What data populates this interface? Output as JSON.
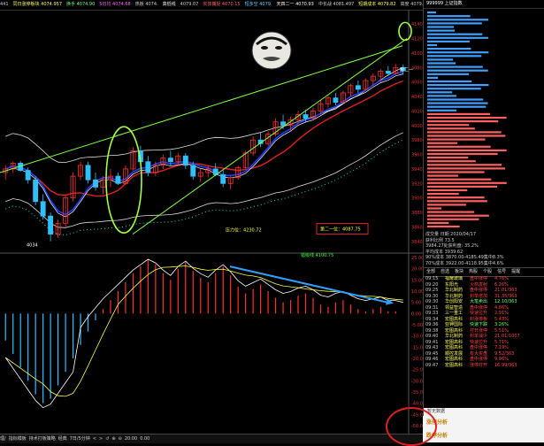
{
  "topbar": {
    "items": [
      {
        "text": "441",
        "color": "#cccccc"
      },
      {
        "text": "同日涨停板块 4074.957",
        "color": "#ffff66"
      },
      {
        "text": "换手 4074.90",
        "color": "#66ff66"
      },
      {
        "text": "5日均 4074.68",
        "color": "#ff66ff"
      },
      {
        "text": "热板 4074.",
        "color": "#cccccc"
      },
      {
        "text": "高低线",
        "color": "#ffffff"
      },
      {
        "text": "4079.07",
        "color": "#cccccc"
      },
      {
        "text": "实体捕捉 4070.15",
        "color": "#ff6666"
      },
      {
        "text": "短多空 4079.",
        "color": "#66ccff"
      },
      {
        "text": "天四二一 4070.93",
        "color": "#ffffff"
      },
      {
        "text": "中长战 4081.497",
        "color": "#cccccc"
      },
      {
        "text": "短期成本 4079.82",
        "color": "#ffff66"
      },
      {
        "text": "高度 4079.02",
        "color": "#cccccc"
      },
      {
        "text": "中期成本 4051.60",
        "color": "#66ff66"
      },
      {
        "text": "MA55 3984.77",
        "color": "#cccccc"
      },
      {
        "text": "MA60 4061.61",
        "color": "#ff66ff"
      }
    ]
  },
  "meme": {
    "caption": "骚好骚好"
  },
  "annotations": {
    "pressure_label": "压力位：4230.72",
    "second_label": "第二一位：4087.75",
    "support_label": "错级线 4100.75",
    "low_label": "4034",
    "gu_label": "股二一"
  },
  "chart_data": {
    "type": "line",
    "price_axis_labels": [
      "4140",
      "4120",
      "4100",
      "4080",
      "4060",
      "4040",
      "4020",
      "4000",
      "3980",
      "3960",
      "3940",
      "3920",
      "3900",
      "3880",
      "3860",
      "3840"
    ],
    "macd_axis_labels": [
      "25.00",
      "20.00",
      "15.00",
      "10.00",
      "5.00",
      "0.00",
      "-5.00",
      "-10.00",
      "-15.00",
      "-20.00",
      "-25.00",
      "-30.00",
      "-35.00",
      "-40.00",
      "-45.00",
      "-50.00"
    ],
    "time_labels": [
      "10:30",
      "11:00",
      "13:30",
      "14:00",
      "14:30",
      "10:00",
      "10:30",
      "11:00",
      "13:30",
      "14:00",
      "14:30"
    ],
    "candles": [
      [
        3935,
        3945,
        3925,
        3940
      ],
      [
        3940,
        3950,
        3935,
        3948
      ],
      [
        3948,
        3951,
        3936,
        3938
      ],
      [
        3938,
        3942,
        3920,
        3925
      ],
      [
        3925,
        3930,
        3890,
        3895
      ],
      [
        3895,
        3905,
        3870,
        3875
      ],
      [
        3875,
        3880,
        3840,
        3850
      ],
      [
        3850,
        3870,
        3845,
        3865
      ],
      [
        3865,
        3905,
        3860,
        3900
      ],
      [
        3900,
        3935,
        3895,
        3930
      ],
      [
        3930,
        3950,
        3925,
        3945
      ],
      [
        3945,
        3950,
        3920,
        3925
      ],
      [
        3925,
        3935,
        3910,
        3915
      ],
      [
        3915,
        3930,
        3905,
        3925
      ],
      [
        3925,
        3940,
        3915,
        3930
      ],
      [
        3930,
        3935,
        3918,
        3920
      ],
      [
        3920,
        3945,
        3918,
        3940
      ],
      [
        3940,
        3970,
        3938,
        3965
      ],
      [
        3965,
        3972,
        3945,
        3950
      ],
      [
        3950,
        3958,
        3930,
        3935
      ],
      [
        3935,
        3950,
        3930,
        3945
      ],
      [
        3945,
        3960,
        3940,
        3955
      ],
      [
        3955,
        3965,
        3945,
        3950
      ],
      [
        3950,
        3962,
        3945,
        3958
      ],
      [
        3958,
        3962,
        3940,
        3945
      ],
      [
        3945,
        3950,
        3925,
        3930
      ],
      [
        3930,
        3940,
        3922,
        3935
      ],
      [
        3935,
        3945,
        3928,
        3940
      ],
      [
        3940,
        3948,
        3930,
        3932
      ],
      [
        3932,
        3938,
        3915,
        3920
      ],
      [
        3920,
        3930,
        3912,
        3928
      ],
      [
        3928,
        3945,
        3925,
        3942
      ],
      [
        3942,
        3965,
        3940,
        3962
      ],
      [
        3962,
        3985,
        3958,
        3980
      ],
      [
        3980,
        3990,
        3970,
        3975
      ],
      [
        3975,
        3992,
        3972,
        3988
      ],
      [
        3988,
        4010,
        3985,
        4005
      ],
      [
        4005,
        4015,
        3995,
        4000
      ],
      [
        4000,
        4012,
        3992,
        4008
      ],
      [
        4008,
        4020,
        4002,
        4015
      ],
      [
        4015,
        4022,
        4005,
        4010
      ],
      [
        4010,
        4025,
        4008,
        4020
      ],
      [
        4020,
        4035,
        4015,
        4030
      ],
      [
        4030,
        4042,
        4025,
        4038
      ],
      [
        4038,
        4045,
        4028,
        4032
      ],
      [
        4032,
        4048,
        4030,
        4045
      ],
      [
        4045,
        4058,
        4040,
        4055
      ],
      [
        4055,
        4062,
        4045,
        4050
      ],
      [
        4050,
        4065,
        4048,
        4062
      ],
      [
        4062,
        4072,
        4055,
        4068
      ],
      [
        4068,
        4078,
        4060,
        4075
      ],
      [
        4075,
        4082,
        4068,
        4072
      ],
      [
        4072,
        4085,
        4070,
        4080
      ],
      [
        4080,
        4084,
        4070,
        4076
      ]
    ],
    "macd_hist": [
      -12,
      -18,
      -24,
      -30,
      -36,
      -40,
      -38,
      -32,
      -26,
      -20,
      -14,
      -8,
      -3,
      2,
      6,
      10,
      14,
      18,
      21,
      24,
      22,
      18,
      15,
      20,
      23,
      19,
      16,
      14,
      18,
      21,
      17,
      12,
      9,
      11,
      13,
      10,
      7,
      5,
      6,
      8,
      9,
      7,
      4,
      3,
      5,
      6,
      4,
      2,
      1,
      2,
      3,
      1,
      1,
      0
    ],
    "ylim": [
      3830,
      4150
    ],
    "macd_ylim": [
      -50,
      25
    ]
  },
  "rside": {
    "header": "999999 上证指数",
    "stats": [
      "成交量  日期  2020/04/17",
      "获利比例        73.5",
      "3984.27处获利盘: 35.2%",
      "平均成本 3939.62",
      "90%成本 3870.00-4185.49集中8.3%",
      "70%成本 3922.00-4118.95集中4.6%"
    ],
    "tabs": [
      "全部",
      "自选",
      "板块",
      "热股",
      "个股",
      "信号",
      "提醒"
    ],
    "list": [
      {
        "t": "09:15",
        "name": "福耀玻璃",
        "type": "盘中涨停",
        "v": "4.76%",
        "c": "#ff4444"
      },
      {
        "t": "09:20",
        "name": "东阳光",
        "type": "火箭发射",
        "v": "6.26%",
        "c": "#ff4444"
      },
      {
        "t": "09:25",
        "name": "华北制药",
        "type": "盘中涨停",
        "v": "21.01/363",
        "c": "#ff4444"
      },
      {
        "t": "09:30",
        "name": "华北制药",
        "type": "封单增加",
        "v": "31.35/363",
        "c": "#ff4444"
      },
      {
        "t": "09:30",
        "name": "华创阳安",
        "type": "大笔卖出",
        "v": "12.10/363",
        "c": "#66ff66"
      },
      {
        "t": "09:31",
        "name": "领益智造",
        "type": "盘中涨停",
        "v": "4.86%",
        "c": "#ff4444"
      },
      {
        "t": "09:33",
        "name": "三一重工",
        "type": "快速拉升",
        "v": "2.91%",
        "c": "#ff4444"
      },
      {
        "t": "09:34",
        "name": "宏图高科",
        "type": "封涨停板",
        "v": "5.43%",
        "c": "#ff4444"
      },
      {
        "t": "09:36",
        "name": "亚钾国际",
        "type": "快速下跌",
        "v": "3.26%",
        "c": "#66ff66"
      },
      {
        "t": "09:38",
        "name": "宏图高科",
        "type": "打开涨停",
        "v": "5.51%",
        "c": "#ff4444"
      },
      {
        "t": "09:40",
        "name": "华北制药",
        "type": "封单减少",
        "v": "21.01/1007",
        "c": "#ff4444"
      },
      {
        "t": "09:41",
        "name": "宏图高科",
        "type": "快速拉升",
        "v": "5.71%",
        "c": "#ff4444"
      },
      {
        "t": "09:43",
        "name": "宏图高科",
        "type": "盘中涨停",
        "v": "7.19%",
        "c": "#ff4444"
      },
      {
        "t": "09:45",
        "name": "顺控发展",
        "type": "有大买盘",
        "v": "9.52/363",
        "c": "#ff4444"
      },
      {
        "t": "09:46",
        "name": "宏图高科",
        "type": "盘中涨停",
        "v": "9.96%",
        "c": "#ff4444"
      },
      {
        "t": "09:47",
        "name": "宏图高科",
        "type": "涨停打开",
        "v": "16.99/363",
        "c": "#ff4444"
      }
    ],
    "notice": "暂无数据",
    "panel1": {
      "title": "涨停分析",
      "cols": [
        "发生日期",
        "时间",
        "类型",
        "封单金额(元)"
      ]
    },
    "panel2": {
      "title": "跌停分析",
      "cols": [
        "发生日期",
        "时间",
        "类型",
        "封单金额(元)"
      ]
    }
  },
  "statusbar": {
    "items": [
      "理/",
      "指标模板",
      "持术打板策略",
      "经典",
      "7日/5分钟",
      "<",
      ">",
      "↺",
      "⊕",
      "⊖",
      "20:00",
      "0.00"
    ]
  }
}
